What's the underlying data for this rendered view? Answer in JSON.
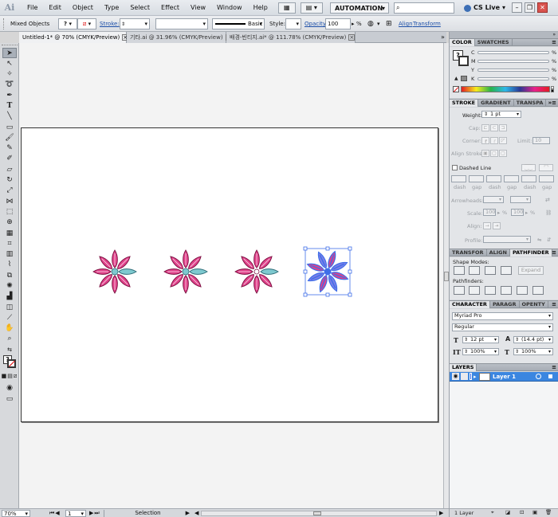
{
  "app": {
    "logo": "Ai"
  },
  "menubar": {
    "items": [
      "File",
      "Edit",
      "Object",
      "Type",
      "Select",
      "Effect",
      "View",
      "Window",
      "Help"
    ],
    "workspace": "AUTOMATION",
    "cs_live": "CS Live",
    "window_buttons": [
      "–",
      "❐",
      "✕"
    ]
  },
  "controlbar": {
    "selection_type": "Mixed Objects",
    "stroke_label": "Stroke:",
    "brush_label": "Basic",
    "style_label": "Style:",
    "opacity_label": "Opacity:",
    "opacity_value": "100",
    "opacity_unit": "%",
    "align_label": "Align",
    "transform_label": "Transform"
  },
  "tabs": [
    {
      "label": "Untitled-1* @ 70% (CMYK/Preview)",
      "active": true
    },
    {
      "label": "기타.ai @ 31.96% (CMYK/Preview)",
      "active": false
    },
    {
      "label": "배경-빈티지.ai* @ 111.78% (CMYK/Preview)",
      "active": false
    }
  ],
  "panels": {
    "color": {
      "tabs": [
        "COLOR",
        "SWATCHES"
      ],
      "channels": [
        {
          "label": "C",
          "unit": "%"
        },
        {
          "label": "M",
          "unit": "%"
        },
        {
          "label": "Y",
          "unit": "%"
        },
        {
          "label": "K",
          "unit": "%"
        }
      ]
    },
    "stroke": {
      "tabs": [
        "STROKE",
        "GRADIENT",
        "TRANSPA"
      ],
      "weight_label": "Weight:",
      "weight_value": "1 pt",
      "cap_label": "Cap:",
      "corner_label": "Corner:",
      "limit_label": "Limit:",
      "limit_value": "10",
      "align_stroke_label": "Align Stroke:",
      "dashed_line_label": "Dashed Line",
      "dash_labels": [
        "dash",
        "gap",
        "dash",
        "gap",
        "dash",
        "gap"
      ],
      "arrowheads_label": "Arrowheads:",
      "scale_label": "Scale:",
      "scale_value_1": "100",
      "scale_value_2": "100",
      "pct": "%",
      "align_label": "Align:",
      "profile_label": "Profile:"
    },
    "pathfinder": {
      "tabs": [
        "TRANSFOR",
        "ALIGN",
        "PATHFINDER"
      ],
      "shape_modes_label": "Shape Modes:",
      "expand_label": "Expand",
      "pathfinders_label": "Pathfinders:"
    },
    "character": {
      "tabs": [
        "CHARACTER",
        "PARAGR",
        "OPENTY"
      ],
      "font_family": "Myriad Pro",
      "font_style": "Regular",
      "font_size": "12 pt",
      "leading": "(14.4 pt)",
      "horizontal_scale": "100%",
      "vertical_scale": "100%"
    },
    "layers": {
      "tabs": [
        "LAYERS"
      ],
      "layer_name": "Layer 1",
      "footer_count": "1 Layer"
    }
  },
  "statusbar": {
    "zoom": "70%",
    "artboard": "1",
    "mode": "Selection"
  },
  "colors": {
    "petal_pink": "#e0428a",
    "petal_blue": "#7ec9cf",
    "selection": "#3f6fe8",
    "layer_highlight": "#3b86e0"
  }
}
